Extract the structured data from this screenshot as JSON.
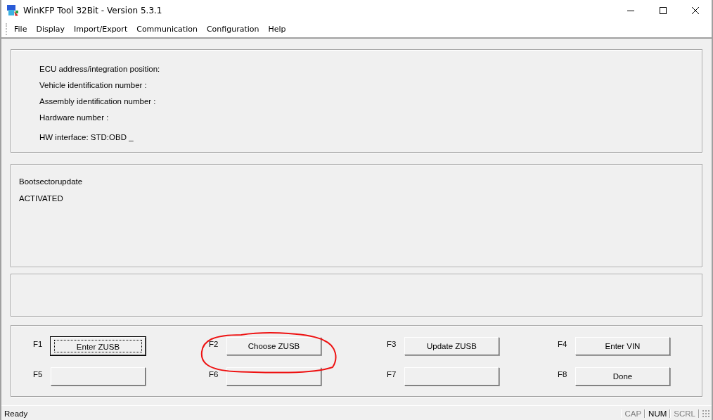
{
  "window": {
    "title": "WinKFP Tool 32Bit - Version 5.3.1"
  },
  "menu": [
    "File",
    "Display",
    "Import/Export",
    "Communication",
    "Configuration",
    "Help"
  ],
  "info_panel": {
    "lines": [
      "ECU address/integration position:",
      "Vehicle identification number :",
      "Assembly identification number :",
      "Hardware number :",
      "HW interface:  STD:OBD _"
    ]
  },
  "message_panel": {
    "lines": [
      "Bootsectorupdate",
      "ACTIVATED"
    ]
  },
  "function_keys": [
    {
      "key": "F1",
      "label": "Enter ZUSB",
      "focused": true,
      "circled": false
    },
    {
      "key": "F2",
      "label": "Choose ZUSB",
      "focused": false,
      "circled": true
    },
    {
      "key": "F3",
      "label": "Update ZUSB",
      "focused": false,
      "circled": false
    },
    {
      "key": "F4",
      "label": "Enter VIN",
      "focused": false,
      "circled": false
    },
    {
      "key": "F5",
      "focused": false,
      "circled": false
    },
    {
      "key": "F6",
      "focused": false,
      "circled": false
    },
    {
      "key": "F7",
      "focused": false,
      "circled": false
    },
    {
      "key": "F8",
      "label": "Done",
      "focused": false,
      "circled": false
    }
  ],
  "status_bar": {
    "text": "Ready",
    "indicators": [
      {
        "label": "CAP",
        "on": false
      },
      {
        "label": "NUM",
        "on": true
      },
      {
        "label": "SCRL",
        "on": false
      }
    ]
  }
}
